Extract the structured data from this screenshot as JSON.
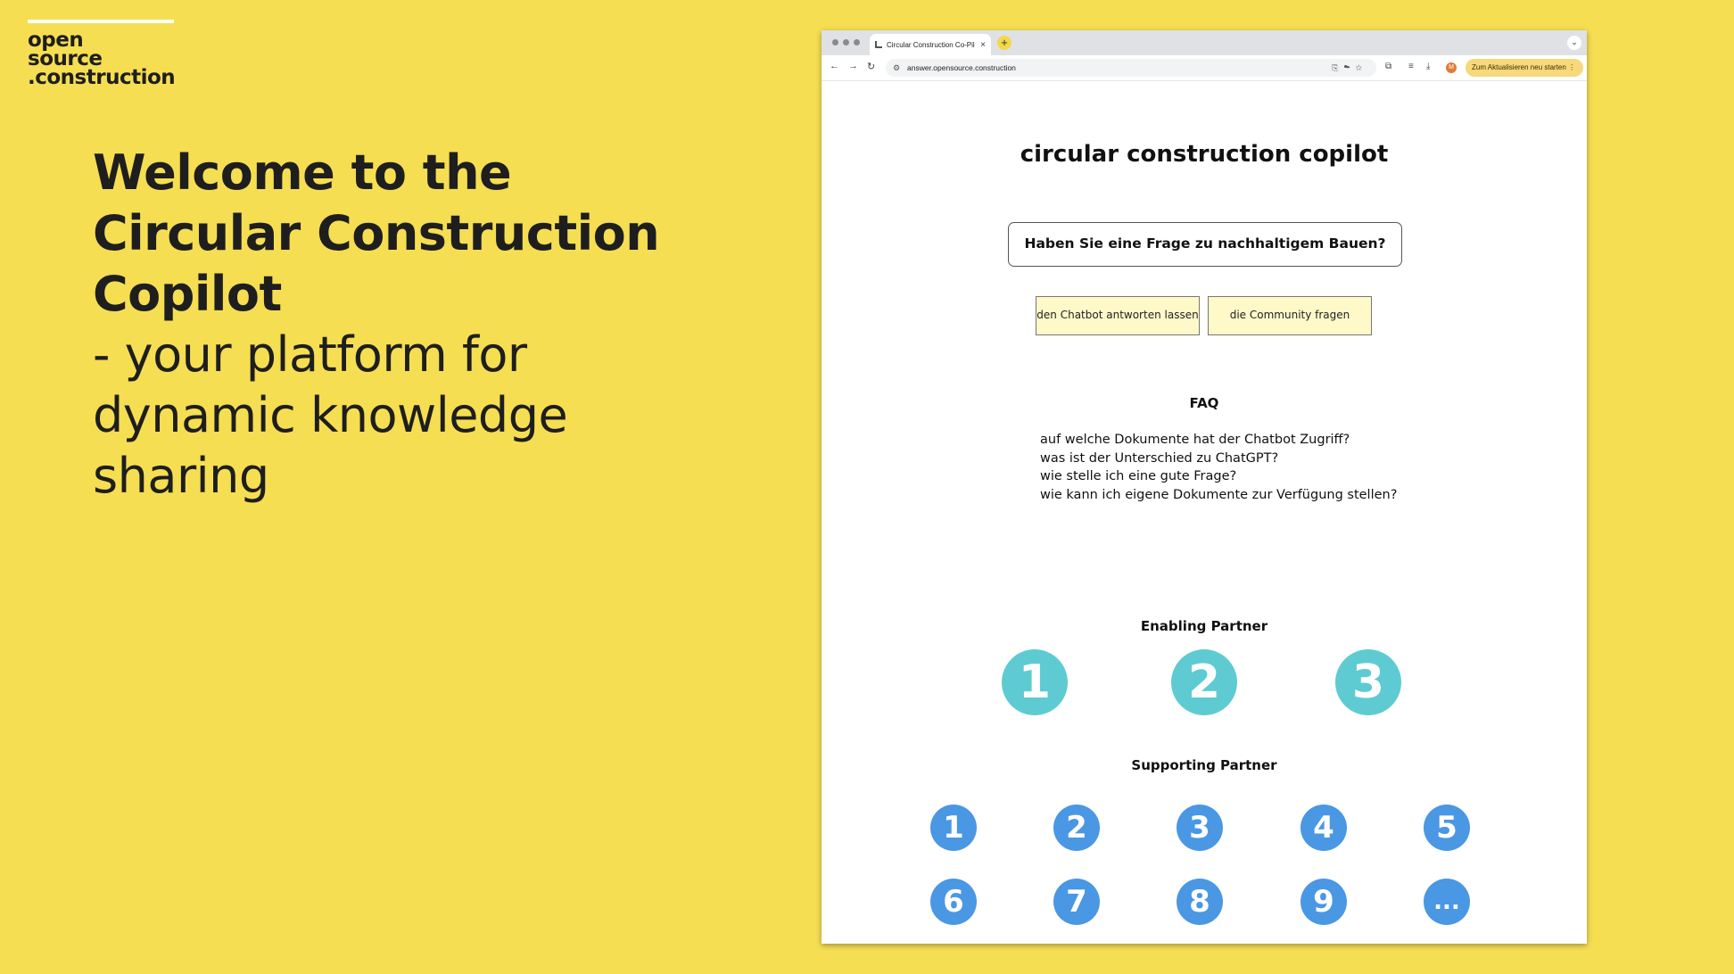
{
  "logo": {
    "lines": [
      "open",
      "source",
      ".construction"
    ]
  },
  "headline": {
    "bold_lines": [
      "Welcome to the",
      "Circular Construction",
      "Copilot"
    ],
    "regular_lines": [
      "- your platform for",
      "dynamic knowledge",
      "sharing"
    ]
  },
  "browser": {
    "tab_title": "Circular Construction Co-Pil",
    "url": "answer.opensource.construction",
    "avatar_letter": "M",
    "update_label": "Zum Aktualisieren neu starten"
  },
  "page": {
    "title": "circular construction copilot",
    "search_prompt": "Haben Sie eine Frage zu nachhaltigem Bauen?",
    "btn_chatbot": "den Chatbot antworten lassen",
    "btn_community": "die Community fragen",
    "faq_title": "FAQ",
    "faq": [
      "auf welche Dokumente hat der Chatbot Zugriff?",
      "was ist der Unterschied zu ChatGPT?",
      "wie stelle ich eine gute Frage?",
      "wie kann ich eigene Dokumente zur Verfügung stellen?"
    ],
    "enabling_title": "Enabling Partner",
    "enabling": [
      "1",
      "2",
      "3"
    ],
    "supporting_title": "Supporting Partner",
    "supporting": [
      "1",
      "2",
      "3",
      "4",
      "5",
      "6",
      "7",
      "8",
      "9",
      "..."
    ]
  },
  "colors": {
    "background": "#f6de52",
    "enabling_circle": "#5ecbd2",
    "supporting_circle": "#4a97e4",
    "action_button": "#fff9c9"
  }
}
